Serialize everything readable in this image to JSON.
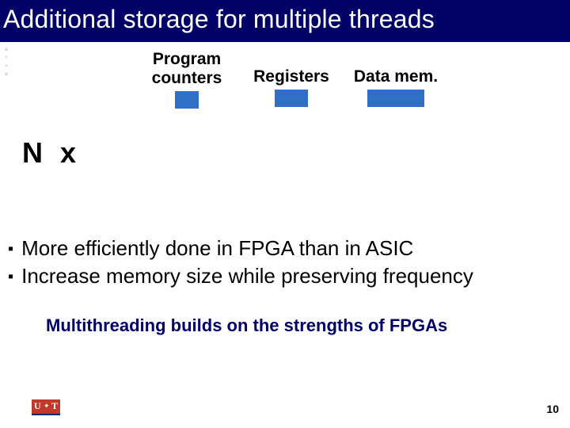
{
  "title": "Additional storage for multiple threads",
  "diagram": {
    "pc_label": "Program\ncounters",
    "reg_label": "Registers",
    "dm_label": "Data mem.",
    "multiplier": "N x"
  },
  "bullets": [
    "More efficiently done in FPGA than in ASIC",
    "Increase memory size while preserving frequency"
  ],
  "callout": "Multithreading builds on the strengths of FPGAs",
  "logo": {
    "left": "U",
    "right": "T",
    "glyph": "✦",
    "name": "university-of-toronto-logo"
  },
  "page_number": "10"
}
